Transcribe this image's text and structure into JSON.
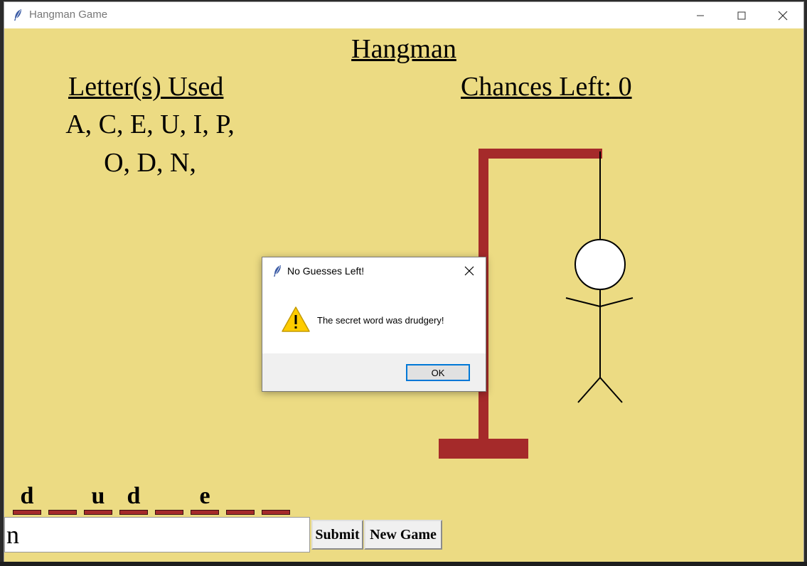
{
  "window": {
    "title": "Hangman Game",
    "controls": [
      "minimize",
      "maximize",
      "close"
    ]
  },
  "game": {
    "heading": "Hangman",
    "used_label": "Letter(s) Used",
    "used_lines": [
      "A, C, E, U, I, P,",
      "O, D, N,"
    ],
    "chances_label": "Chances Left:",
    "chances_value": "0",
    "word_slots": [
      "d",
      "",
      "u",
      "d",
      "",
      "e",
      "",
      ""
    ],
    "input_value": "n",
    "submit_label": "Submit",
    "new_game_label": "New Game"
  },
  "dialog": {
    "title": "No Guesses Left!",
    "message": "The secret word was drudgery!",
    "ok_label": "OK",
    "icon": "warning-icon"
  },
  "colors": {
    "background": "#ecdb83",
    "gallows": "#a52a2a",
    "warning": "#ffcc00",
    "dialog_focus": "#0078d7"
  }
}
